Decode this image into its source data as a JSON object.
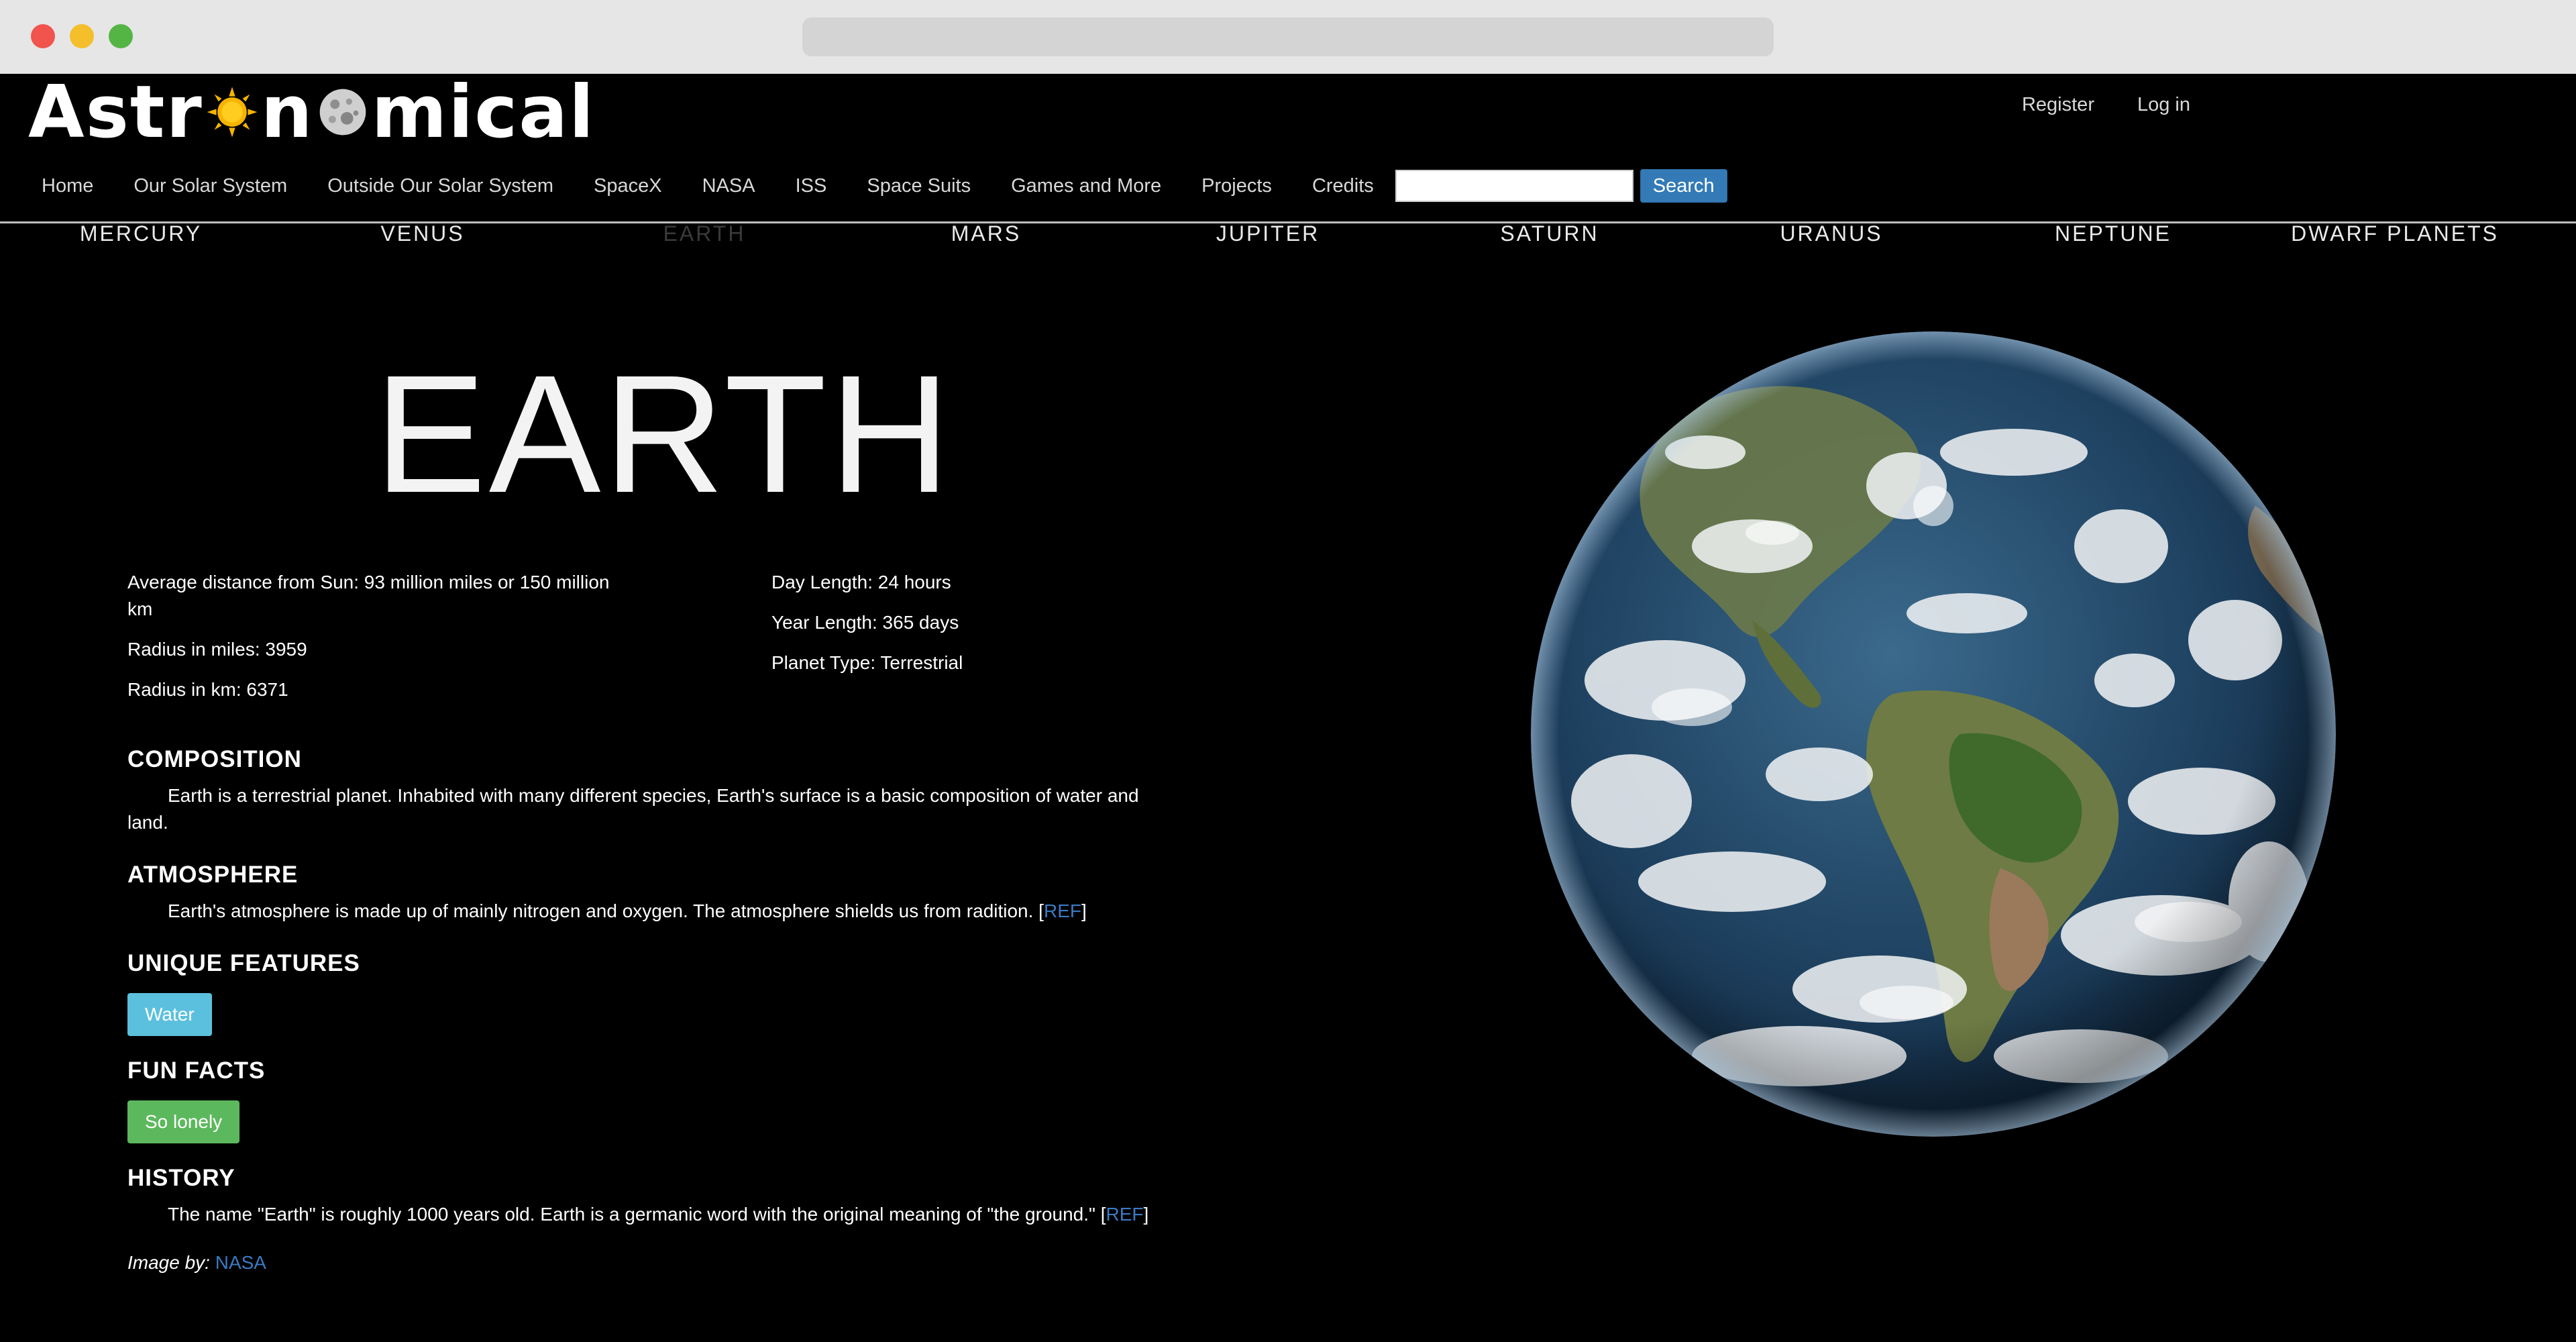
{
  "site": {
    "logo_prefix": "Astr",
    "logo_mid": "n",
    "logo_suffix": "mical"
  },
  "account": {
    "register": "Register",
    "login": "Log in"
  },
  "nav": {
    "items": [
      "Home",
      "Our Solar System",
      "Outside Our Solar System",
      "SpaceX",
      "NASA",
      "ISS",
      "Space Suits",
      "Games and More",
      "Projects",
      "Credits"
    ],
    "search_value": "",
    "search_button": "Search"
  },
  "planets": [
    "MERCURY",
    "VENUS",
    "EARTH",
    "MARS",
    "JUPITER",
    "SATURN",
    "URANUS",
    "NEPTUNE",
    "DWARF PLANETS"
  ],
  "active_planet": "EARTH",
  "page": {
    "title": "EARTH",
    "stats_left": [
      "Average distance from Sun: 93 million miles or 150 million km",
      "Radius in miles: 3959",
      "Radius in km: 6371"
    ],
    "stats_right": [
      "Day Length: 24 hours",
      "Year Length: 365 days",
      "Planet Type: Terrestrial"
    ],
    "composition": {
      "heading": "COMPOSITION",
      "text": "Earth is a terrestrial planet. Inhabited with many different species, Earth's surface is a basic composition of water and land."
    },
    "atmosphere": {
      "heading": "ATMOSPHERE",
      "text": "Earth's atmosphere is made up of mainly nitrogen and oxygen. The atmosphere shields us from radition. [",
      "ref": "REF",
      "close": "]"
    },
    "unique": {
      "heading": "UNIQUE FEATURES",
      "badge": "Water"
    },
    "fun": {
      "heading": "FUN FACTS",
      "badge": "So lonely"
    },
    "history": {
      "heading": "HISTORY",
      "text": "The name \"Earth\" is roughly 1000 years old. Earth is a germanic word with the original meaning of \"the ground.\" [",
      "ref": "REF",
      "close": "]"
    },
    "credit": {
      "label": "Image by: ",
      "link": "NASA"
    }
  },
  "colors": {
    "background": "#000000",
    "link": "#3b7ac2",
    "search_button": "#337ab7",
    "badge_info": "#5bc0de",
    "badge_success": "#5cb85c"
  }
}
